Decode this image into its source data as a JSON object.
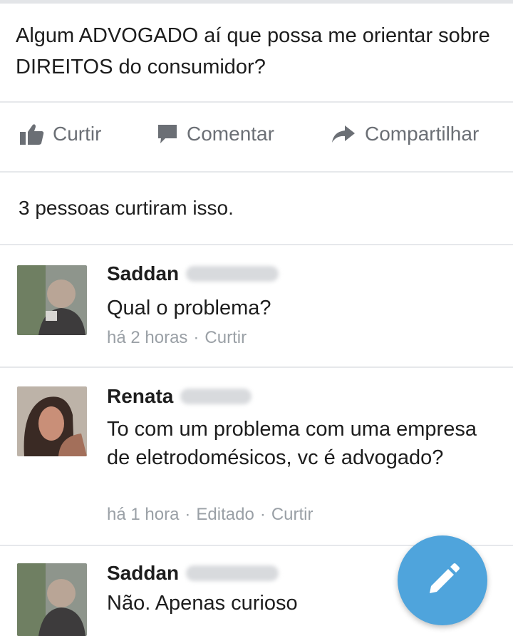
{
  "post": {
    "text": "Algum ADVOGADO aí que possa me orientar sobre DIREITOS do consumidor?"
  },
  "actions": {
    "like_label": "Curtir",
    "comment_label": "Comentar",
    "share_label": "Compartilhar"
  },
  "likes_summary": "3 pessoas curtiram isso.",
  "comments": [
    {
      "name": "Saddan",
      "text": "Qual o problema?",
      "time": "há 2 horas",
      "edited": "",
      "like_label": "Curtir"
    },
    {
      "name": "Renata",
      "text": "To com um problema com uma empresa de eletrodomésicos, vc é advogado?",
      "time": "há 1 hora",
      "edited": "Editado",
      "like_label": "Curtir"
    },
    {
      "name": "Saddan",
      "text": "Não. Apenas curioso"
    }
  ],
  "icons": {
    "like": "thumbs-up-icon",
    "comment": "speech-bubble-icon",
    "share": "share-arrow-icon",
    "compose": "pencil-icon"
  },
  "colors": {
    "fab": "#4fa4dc",
    "action_text": "#6b6f75",
    "meta_text": "#9aa0a6"
  }
}
